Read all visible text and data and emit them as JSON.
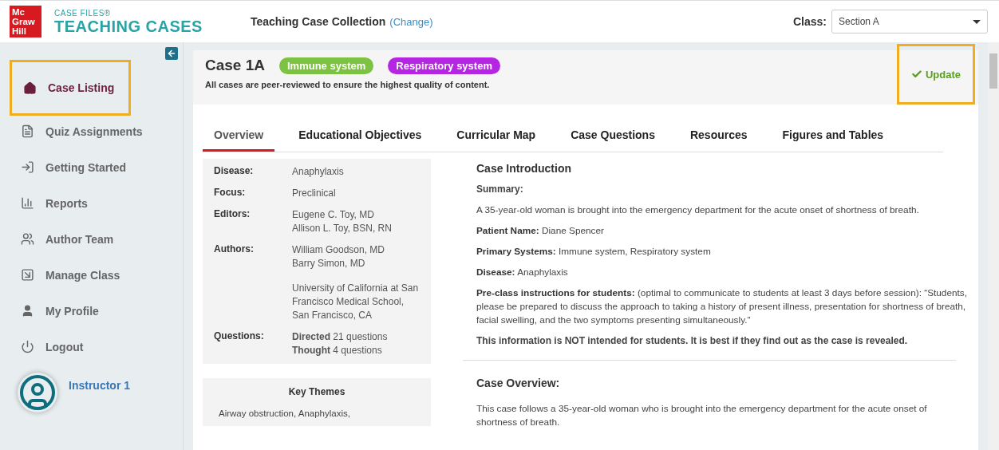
{
  "header": {
    "logo": [
      "Mc",
      "Graw",
      "Hill"
    ],
    "product_small": "CASE FILES®",
    "product_name": "TEACHING CASES",
    "collection": "Teaching Case Collection",
    "change_link": "(Change)",
    "class_label": "Class:",
    "class_value": "Section A"
  },
  "sidebar": {
    "items": [
      {
        "label": "Case Listing",
        "selected": true
      },
      {
        "label": "Quiz Assignments",
        "selected": false
      },
      {
        "label": "Getting Started",
        "selected": false
      },
      {
        "label": "Reports",
        "selected": false
      },
      {
        "label": "Author Team",
        "selected": false
      },
      {
        "label": "Manage Class",
        "selected": false
      },
      {
        "label": "My Profile",
        "selected": false
      },
      {
        "label": "Logout",
        "selected": false
      }
    ],
    "user": "Instructor 1"
  },
  "case": {
    "title": "Case 1A",
    "tags": [
      {
        "label": "Immune system",
        "color": "#7dc242"
      },
      {
        "label": "Respiratory system",
        "color": "#b526e3"
      }
    ],
    "subtitle": "All cases are peer-reviewed to ensure the highest quality of content.",
    "update_button": "Update"
  },
  "tabs": [
    {
      "label": "Overview",
      "selected": true
    },
    {
      "label": "Educational Objectives",
      "selected": false
    },
    {
      "label": "Curricular Map",
      "selected": false
    },
    {
      "label": "Case Questions",
      "selected": false
    },
    {
      "label": "Resources",
      "selected": false
    },
    {
      "label": "Figures and Tables",
      "selected": false
    }
  ],
  "details": [
    {
      "label": "Disease:",
      "values": [
        "Anaphylaxis"
      ]
    },
    {
      "label": "Focus:",
      "values": [
        "Preclinical"
      ]
    },
    {
      "label": "Editors:",
      "values": [
        "Eugene C. Toy, MD\nAllison L. Toy, BSN, RN"
      ]
    },
    {
      "label": "Authors:",
      "values": [
        "William Goodson, MD\nBarry Simon, MD",
        "University of California at San Francisco Medical School, San Francisco, CA"
      ]
    },
    {
      "label": "Questions:",
      "values": [
        "**Directed** 21 questions\n**Thought** 4 questions"
      ]
    }
  ],
  "key_themes": {
    "title": "Key Themes",
    "text": "Airway obstruction, Anaphylaxis,"
  },
  "introduction": {
    "title": "Case Introduction",
    "paragraphs": [
      {
        "kind": "heading",
        "text": "Summary:"
      },
      {
        "kind": "text",
        "text": "A 35-year-old woman is brought into the emergency department for the acute onset of shortness of breath."
      },
      {
        "kind": "text",
        "text": "**Patient Name:** Diane Spencer"
      },
      {
        "kind": "text",
        "text": "**Primary Systems:** Immune system, Respiratory system"
      },
      {
        "kind": "text",
        "text": "**Disease:** Anaphylaxis"
      },
      {
        "kind": "text",
        "text": "**Pre-class instructions for students:** (optimal to communicate to students at least 3 days before session): “Students, please be prepared to discuss the approach to taking a history of present illness, presentation for shortness of breath, facial swelling, and the two symptoms presenting simultaneously.”"
      },
      {
        "kind": "heading",
        "text": "This information is NOT intended for students. It is best if they find out as the case is revealed."
      }
    ]
  },
  "overview": {
    "title": "Case Overview:",
    "text": "This case follows a 35-year-old woman who is brought into the emergency department for the acute onset of shortness of breath."
  }
}
